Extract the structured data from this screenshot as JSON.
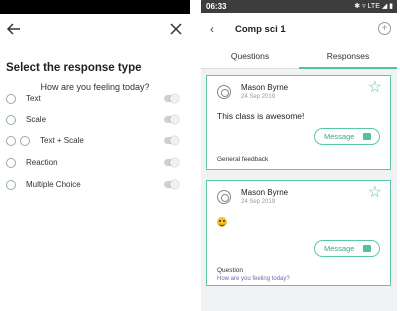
{
  "left": {
    "title": "Select the response type",
    "question": "How are you feeling today?",
    "options": [
      {
        "label": "Text"
      },
      {
        "label": "Scale"
      },
      {
        "label": "Text + Scale"
      },
      {
        "label": "Reaction"
      },
      {
        "label": "Multiple Choice"
      }
    ]
  },
  "right": {
    "status": {
      "time": "06:33",
      "icons": "✱ ▿ LTE ◢ ▮"
    },
    "header": {
      "back": "‹",
      "course": "Comp sci 1",
      "add": "+"
    },
    "tabs": [
      {
        "label": "Questions"
      },
      {
        "label": "Responses"
      }
    ],
    "cards": [
      {
        "name": "Mason Byrne",
        "date": "24 Sep 2019",
        "body": "This class is awesome!",
        "button": "Message",
        "footer": "General feedback",
        "sub": ""
      },
      {
        "name": "Mason Byrne",
        "date": "24 Sep 2019",
        "body": "",
        "button": "Message",
        "footer": "Question",
        "sub": "How are you feeling today?"
      }
    ]
  },
  "colors": {
    "accent": "#5cc6a8"
  }
}
